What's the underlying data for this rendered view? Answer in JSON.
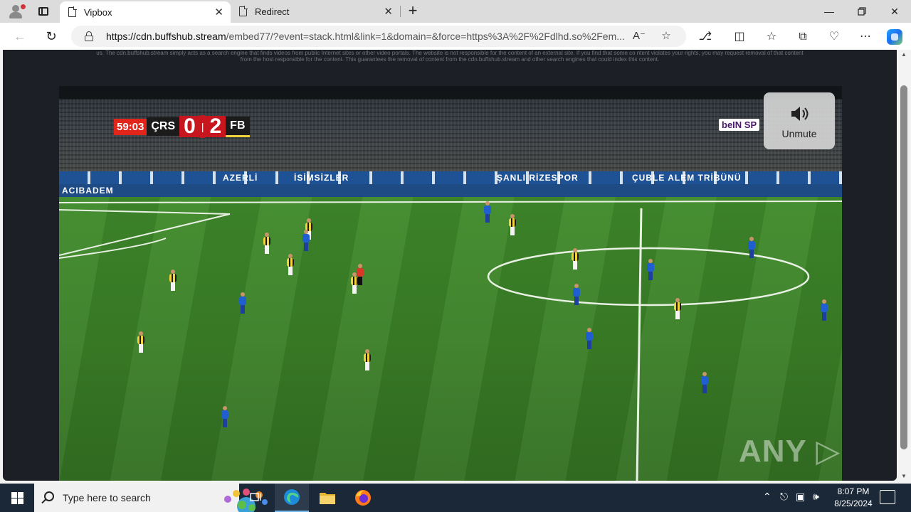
{
  "browser": {
    "tabs": [
      {
        "title": "Vipbox",
        "active": true
      },
      {
        "title": "Redirect",
        "active": false
      }
    ],
    "url_host": "https://cdn.buffshub.stream",
    "url_path": "/embed77/?event=stack.html&link=1&domain=&force=https%3A%2F%2Fdlhd.so%2Fem..."
  },
  "page": {
    "disclaimer": "us. The cdn.buffshub.stream simply acts as a search engine that finds videos from public Internet sites or other video portals. The website is not responsible for the content of an external site. If you find that some co ntent violates your rights, you may request removal of that content from the host responsible for the content. This guarantees the removal of content from the cdn.buffshub.stream and other search engines that could index this content."
  },
  "video": {
    "match_time": "59:03",
    "home_team": "ÇRS",
    "home_score": "0",
    "away_team": "FB",
    "away_score": "2",
    "broadcaster": "beIN SP",
    "unmute_label": "Unmute",
    "watermark": "ANY ▷ RUN",
    "ad_texts": [
      "ACIBADEM",
      "AZERLİ",
      "İSİMSİZLER",
      "ŞANLI RİZESPOR",
      "ÇUBLE ALEM TRİBÜNÜ"
    ],
    "colors": {
      "home_kit": "#1f5fd0",
      "away_kit": "#f2d43a",
      "score_red": "#c7161d"
    }
  },
  "taskbar": {
    "search_placeholder": "Type here to search",
    "time": "8:07 PM",
    "date": "8/25/2024",
    "apps": [
      "task-view",
      "edge",
      "file-explorer",
      "firefox"
    ]
  }
}
